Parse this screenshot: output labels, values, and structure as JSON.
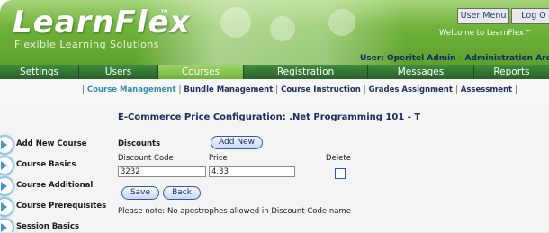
{
  "header": {
    "logo_text": "LearnFlex",
    "logo_tm": "™",
    "tagline": "Flexible Learning Solutions",
    "user_menu_label": "User Menu",
    "logout_label": "Log O",
    "welcome_text": "Welcome to LearnFlex™",
    "user_line": "User: Operitel Admin - Administration Are"
  },
  "nav": {
    "tabs": [
      {
        "label": "Settings"
      },
      {
        "label": "Users"
      },
      {
        "label": "Courses"
      },
      {
        "label": "Registration"
      },
      {
        "label": "Messages"
      },
      {
        "label": "Reports"
      }
    ]
  },
  "subnav": {
    "items": [
      {
        "label": "Course Management"
      },
      {
        "label": "Bundle Management"
      },
      {
        "label": "Course Instruction"
      },
      {
        "label": "Grades Assignment"
      },
      {
        "label": "Assessment"
      }
    ]
  },
  "sidebar": {
    "items": [
      {
        "label": "Add New Course"
      },
      {
        "label": "Course Basics"
      },
      {
        "label": "Course Additional"
      },
      {
        "label": "Course Prerequisites"
      },
      {
        "label": "Session Basics"
      }
    ]
  },
  "main": {
    "title": "E-Commerce Price Configuration: .Net Programming 101 - T",
    "discounts_label": "Discounts",
    "add_new_label": "Add New",
    "col_code": "Discount Code",
    "col_price": "Price",
    "col_delete": "Delete",
    "row": {
      "code": "3232",
      "price": "4.33"
    },
    "save_label": "Save",
    "back_label": "Back",
    "note": "Please note: No apostrophes allowed in Discount Code name"
  }
}
